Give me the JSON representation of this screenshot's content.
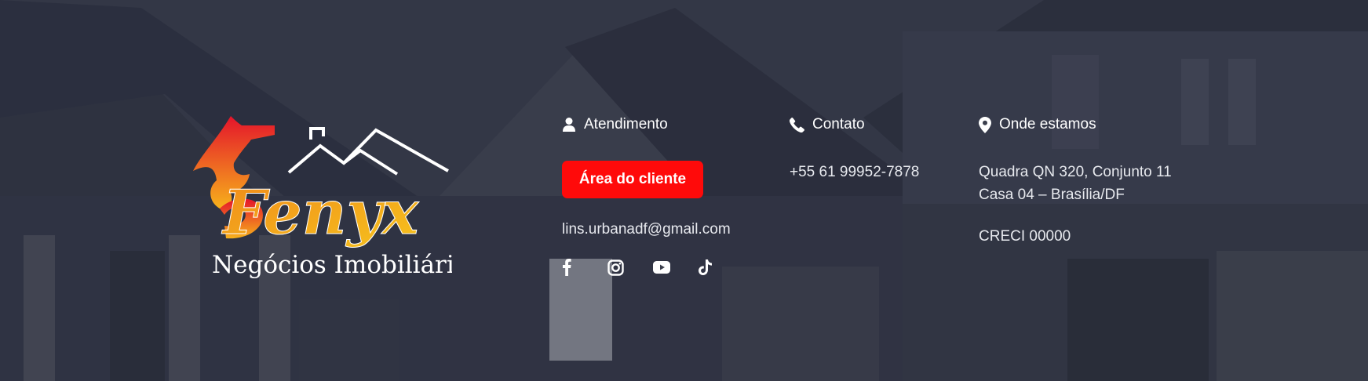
{
  "brand": {
    "logo_word": "Fenyx",
    "logo_subtitle": "Negócios Imobiliários",
    "colors": {
      "flame_start": "#e4142b",
      "flame_end": "#f7b21b",
      "accent": "#ff0a0a",
      "text": "#ffffff"
    }
  },
  "atendimento": {
    "title": "Atendimento",
    "icon": "user-icon",
    "button_label": "Área do cliente",
    "email": "lins.urbanadf@gmail.com",
    "social": [
      {
        "name": "facebook-icon"
      },
      {
        "name": "instagram-icon"
      },
      {
        "name": "youtube-icon"
      },
      {
        "name": "tiktok-icon"
      }
    ]
  },
  "contato": {
    "title": "Contato",
    "icon": "phone-icon",
    "phone": "+55 61 99952-7878"
  },
  "onde_estamos": {
    "title": "Onde estamos",
    "icon": "location-pin-icon",
    "address_line1": "Quadra QN 320, Conjunto 11",
    "address_line2": "Casa 04 – Brasília/DF",
    "creci": "CRECI 00000"
  }
}
